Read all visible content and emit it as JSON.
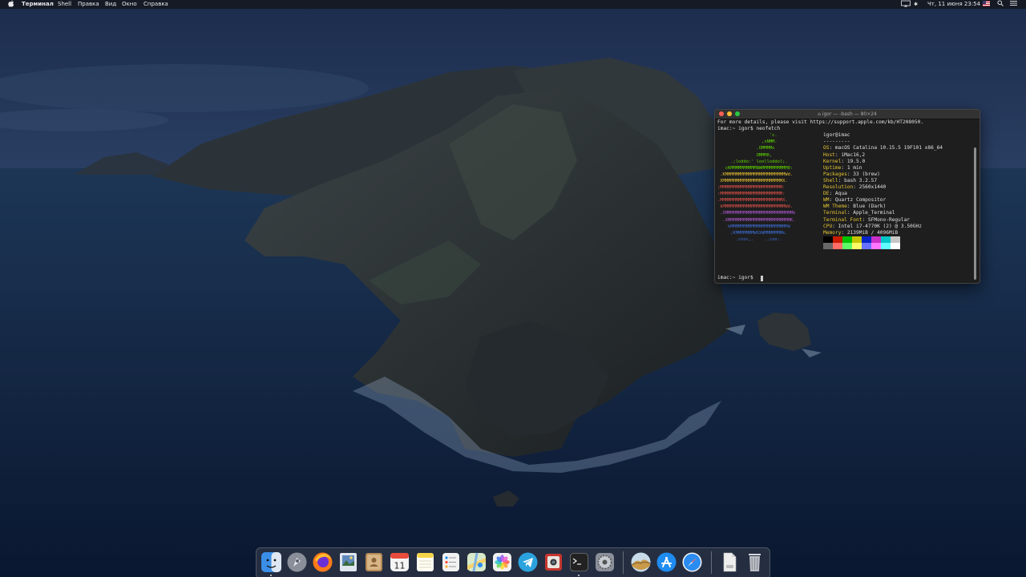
{
  "menubar": {
    "app_name": "Терминал",
    "menus": [
      "Shell",
      "Правка",
      "Вид",
      "Окно",
      "Справка"
    ],
    "datetime": "Чт, 11 июня  23:54"
  },
  "terminal": {
    "title": "igor — -bash — 80×24",
    "intro_line": "For more details, please visit https://support.apple.com/kb/HT208050.",
    "prompt1": "imac:~ igor$ neofetch",
    "prompt2": "imac:~ igor$ ",
    "user_host": "igor@imac",
    "separator": "---------",
    "info": [
      {
        "key": "OS",
        "value": "macOS Catalina 10.15.5 19F101 x86_64"
      },
      {
        "key": "Host",
        "value": "iMac16,2"
      },
      {
        "key": "Kernel",
        "value": "19.5.0"
      },
      {
        "key": "Uptime",
        "value": "1 min"
      },
      {
        "key": "Packages",
        "value": "33 (brew)"
      },
      {
        "key": "Shell",
        "value": "bash 3.2.57"
      },
      {
        "key": "Resolution",
        "value": "2560x1440"
      },
      {
        "key": "DE",
        "value": "Aqua"
      },
      {
        "key": "WM",
        "value": "Quartz Compositor"
      },
      {
        "key": "WM Theme",
        "value": "Blue (Dark)"
      },
      {
        "key": "Terminal",
        "value": "Apple_Terminal"
      },
      {
        "key": "Terminal Font",
        "value": "SFMono-Regular"
      },
      {
        "key": "CPU",
        "value": "Intel i7-4770K (2) @ 3.50GHz"
      },
      {
        "key": "Memory",
        "value": "2139MiB / 4096MiB"
      }
    ],
    "logo_lines": [
      {
        "text": "                    'c.",
        "color": "#5fd700"
      },
      {
        "text": "                 ,xNMM.",
        "color": "#5fd700"
      },
      {
        "text": "               .OMMMMo",
        "color": "#5fd700"
      },
      {
        "text": "               OMMM0,",
        "color": "#5fd700"
      },
      {
        "text": "     .;loddo:' loolloddol;.",
        "color": "#5fd700"
      },
      {
        "text": "   cKMMMMMMMMMMNWMMMMMMMMMM0:",
        "color": "#5fd700"
      },
      {
        "text": " .KMMMMMMMMMMMMMMMMMMMMMMMWd.",
        "color": "#e5c032"
      },
      {
        "text": " XMMMMMMMMMMMMMMMMMMMMMMMX.",
        "color": "#e5c032"
      },
      {
        "text": ";MMMMMMMMMMMMMMMMMMMMMMMM:",
        "color": "#e5534b"
      },
      {
        "text": ":MMMMMMMMMMMMMMMMMMMMMMMM:",
        "color": "#e5534b"
      },
      {
        "text": ".MMMMMMMMMMMMMMMMMMMMMMMMX.",
        "color": "#e5534b"
      },
      {
        "text": " kMMMMMMMMMMMMMMMMMMMMMMMMWd.",
        "color": "#e5534b"
      },
      {
        "text": " .XMMMMMMMMMMMMMMMMMMMMMMMMMMk",
        "color": "#b35bd6"
      },
      {
        "text": "  .XMMMMMMMMMMMMMMMMMMMMMMMMK.",
        "color": "#b35bd6"
      },
      {
        "text": "    kMMMMMMMMMMMMMMMMMMMMMMd",
        "color": "#3d6fd8"
      },
      {
        "text": "     ;KMMMMMMMWXXWMMMMMMMk.",
        "color": "#3d6fd8"
      },
      {
        "text": "       .cooc,.    .,coo:.",
        "color": "#3d6fd8"
      }
    ],
    "palette_top": [
      "#000000",
      "#c91b00",
      "#00c200",
      "#c7c400",
      "#0225c7",
      "#c930c7",
      "#00c5c7",
      "#c7c7c7"
    ],
    "palette_bottom": [
      "#676767",
      "#ff6d67",
      "#5ff967",
      "#fefb67",
      "#6871ff",
      "#ff76ff",
      "#5ffdff",
      "#feffff"
    ]
  },
  "dock": {
    "apps": [
      {
        "name": "finder-icon",
        "color": "#3a8ee6"
      },
      {
        "name": "launchpad-icon",
        "color": "#8a8f99"
      },
      {
        "name": "firefox-icon",
        "color": "#ff7a1a"
      },
      {
        "name": "preview-icon",
        "color": "#7aa0c8"
      },
      {
        "name": "contacts-icon",
        "color": "#b58a55"
      },
      {
        "name": "calendar-icon",
        "color": "#f4f4f4"
      },
      {
        "name": "notes-icon",
        "color": "#f7d54a"
      },
      {
        "name": "reminders-icon",
        "color": "#f2f2f2"
      },
      {
        "name": "maps-icon",
        "color": "#6cbf6a"
      },
      {
        "name": "photos-icon",
        "color": "#f2f2f2"
      },
      {
        "name": "telegram-icon",
        "color": "#2aa3de"
      },
      {
        "name": "photo-booth-icon",
        "color": "#c6362f"
      },
      {
        "name": "terminal-icon",
        "color": "#222222"
      },
      {
        "name": "system-preferences-icon",
        "color": "#8a8f99"
      },
      {
        "name": "macos-installer-icon",
        "color": "#c89a4a"
      },
      {
        "name": "app-store-icon",
        "color": "#1e8cf0"
      },
      {
        "name": "safari-icon",
        "color": "#2a8cf0"
      },
      {
        "name": "documents-stack-icon",
        "color": "#eeeeee"
      },
      {
        "name": "trash-icon",
        "color": "#b9bcc2"
      }
    ],
    "calendar_day": "11"
  },
  "colors": {
    "menubar_bg": "#16181e",
    "terminal_bg": "#1e1e1e",
    "key_color": "#e6c532"
  }
}
